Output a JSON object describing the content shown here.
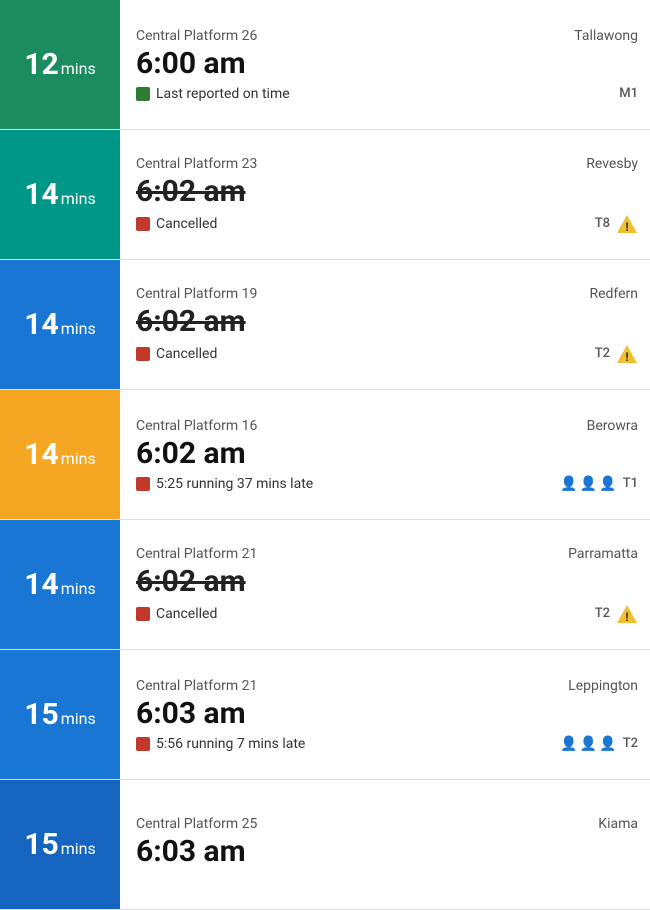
{
  "trains": [
    {
      "id": "train-1",
      "minutes": "12",
      "badge_color": "badge-green",
      "platform": "Central Platform 26",
      "destination": "Tallawong",
      "departure": "6:00 am",
      "departure_strikethrough": false,
      "status_text": "Last reported on time",
      "status_color": "green",
      "line": "M1",
      "show_warning": false,
      "show_crowding": false
    },
    {
      "id": "train-2",
      "minutes": "14",
      "badge_color": "badge-teal",
      "platform": "Central Platform 23",
      "destination": "Revesby",
      "departure": "6:02 am",
      "departure_strikethrough": true,
      "status_text": "Cancelled",
      "status_color": "red",
      "line": "T8",
      "show_warning": true,
      "show_crowding": false
    },
    {
      "id": "train-3",
      "minutes": "14",
      "badge_color": "badge-blue",
      "platform": "Central Platform 19",
      "destination": "Redfern",
      "departure": "6:02 am",
      "departure_strikethrough": true,
      "status_text": "Cancelled",
      "status_color": "red",
      "line": "T2",
      "show_warning": true,
      "show_crowding": false
    },
    {
      "id": "train-4",
      "minutes": "14",
      "badge_color": "badge-orange",
      "platform": "Central Platform 16",
      "destination": "Berowra",
      "departure": "6:02 am",
      "departure_strikethrough": false,
      "status_text": "5:25 running 37 mins late",
      "status_color": "red",
      "line": "T1",
      "show_warning": false,
      "show_crowding": true
    },
    {
      "id": "train-5",
      "minutes": "14",
      "badge_color": "badge-blue",
      "platform": "Central Platform 21",
      "destination": "Parramatta",
      "departure": "6:02 am",
      "departure_strikethrough": true,
      "status_text": "Cancelled",
      "status_color": "red",
      "line": "T2",
      "show_warning": true,
      "show_crowding": false
    },
    {
      "id": "train-6",
      "minutes": "15",
      "badge_color": "badge-blue",
      "platform": "Central Platform 21",
      "destination": "Leppington",
      "departure": "6:03 am",
      "departure_strikethrough": false,
      "status_text": "5:56 running 7 mins late",
      "status_color": "red",
      "line": "T2",
      "show_warning": false,
      "show_crowding": true
    },
    {
      "id": "train-7",
      "minutes": "15",
      "badge_color": "badge-dark-blue",
      "platform": "Central Platform 25",
      "destination": "Kiama",
      "departure": "6:03 am",
      "departure_strikethrough": false,
      "status_text": "",
      "status_color": "green",
      "line": "",
      "show_warning": false,
      "show_crowding": false
    }
  ]
}
